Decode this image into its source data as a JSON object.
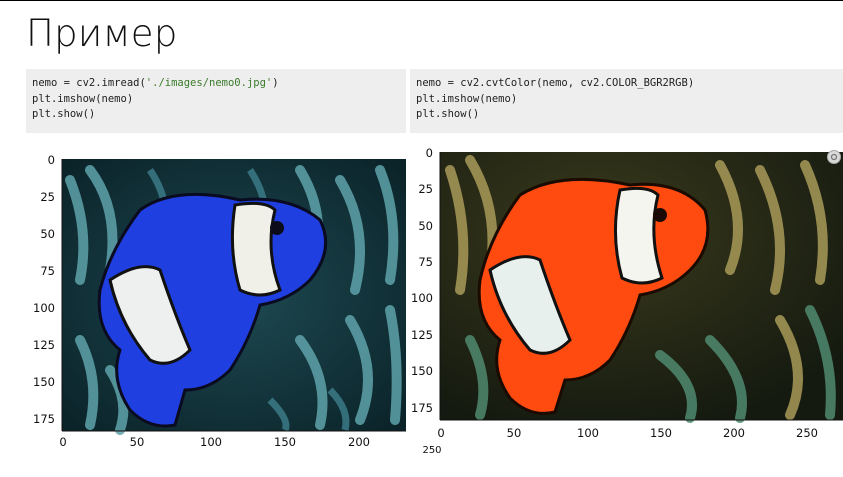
{
  "slide": {
    "title": "Пример"
  },
  "cells": [
    {
      "lines": [
        {
          "pre": "nemo = cv2.imread(",
          "str": "'./images/nemo0.jpg'",
          "post": ")"
        },
        {
          "pre": "plt.imshow(nemo)",
          "str": "",
          "post": ""
        },
        {
          "pre": "plt.show()",
          "str": "",
          "post": ""
        }
      ]
    },
    {
      "lines": [
        {
          "pre": "nemo = cv2.cvtColor(nemo, cv2.COLOR_BGR2RGB)",
          "str": "",
          "post": ""
        },
        {
          "pre": "plt.imshow(nemo)",
          "str": "",
          "post": ""
        },
        {
          "pre": "plt.show()",
          "str": "",
          "post": ""
        }
      ]
    }
  ],
  "plots": [
    {
      "image": "clownfish photo, BGR channel order (fish appears blue)",
      "yticks": [
        "0",
        "25",
        "50",
        "75",
        "100",
        "125",
        "150",
        "175"
      ],
      "xticks": [
        "0",
        "50",
        "100",
        "150",
        "200"
      ]
    },
    {
      "image": "clownfish photo, RGB channel order (fish appears orange)",
      "yticks": [
        "0",
        "25",
        "50",
        "75",
        "100",
        "125",
        "150",
        "175"
      ],
      "xticks": [
        "0",
        "50",
        "100",
        "150",
        "200",
        "250"
      ],
      "clipped_tick": "250"
    }
  ],
  "colors": {
    "code_bg": "#eeeeee",
    "string": "#3a7a2a",
    "fish_bgr": "#1f3fe0",
    "fish_rgb": "#ff4a10",
    "anemone_bgr": "#2f6f7a",
    "anemone_rgb": "#8a7a3a"
  },
  "icons": {
    "cell_toolbar": "settings-icon"
  }
}
